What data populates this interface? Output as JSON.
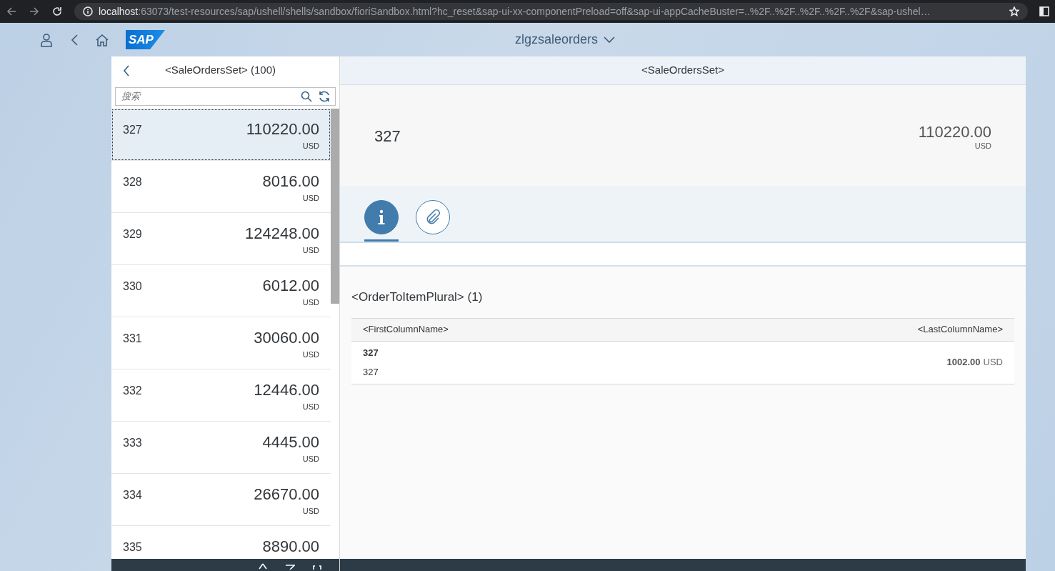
{
  "browser": {
    "url_host": "localhost",
    "url_path": ":63073/test-resources/sap/ushell/shells/sandbox/fioriSandbox.html?hc_reset&sap-ui-xx-componentPreload=off&sap-ui-appCacheBuster=..%2F..%2F..%2F..%2F..%2F&sap-ushel…"
  },
  "shell": {
    "logo": "SAP",
    "title": "zlgzsaleorders"
  },
  "master": {
    "title": "<SaleOrdersSet> (100)",
    "search": {
      "placeholder": "搜索"
    },
    "items": [
      {
        "id": "327",
        "amount": "110220.00",
        "currency": "USD",
        "selected": true
      },
      {
        "id": "328",
        "amount": "8016.00",
        "currency": "USD",
        "selected": false
      },
      {
        "id": "329",
        "amount": "124248.00",
        "currency": "USD",
        "selected": false
      },
      {
        "id": "330",
        "amount": "6012.00",
        "currency": "USD",
        "selected": false
      },
      {
        "id": "331",
        "amount": "30060.00",
        "currency": "USD",
        "selected": false
      },
      {
        "id": "332",
        "amount": "12446.00",
        "currency": "USD",
        "selected": false
      },
      {
        "id": "333",
        "amount": "4445.00",
        "currency": "USD",
        "selected": false
      },
      {
        "id": "334",
        "amount": "26670.00",
        "currency": "USD",
        "selected": false
      },
      {
        "id": "335",
        "amount": "8890.00",
        "selected": false
      }
    ]
  },
  "detail": {
    "title": "<SaleOrdersSet>",
    "object": {
      "id": "327",
      "amount": "110220.00",
      "currency": "USD"
    },
    "tabs": [
      {
        "kind": "info",
        "selected": true
      },
      {
        "kind": "attachment",
        "selected": false
      }
    ],
    "table": {
      "title": "<OrderToItemPlural> (1)",
      "columns": [
        "<FirstColumnName>",
        "<LastColumnName>"
      ],
      "rows": [
        {
          "title": "327",
          "subtitle": "327",
          "amount": "1002.00",
          "currency": "USD"
        }
      ]
    }
  }
}
